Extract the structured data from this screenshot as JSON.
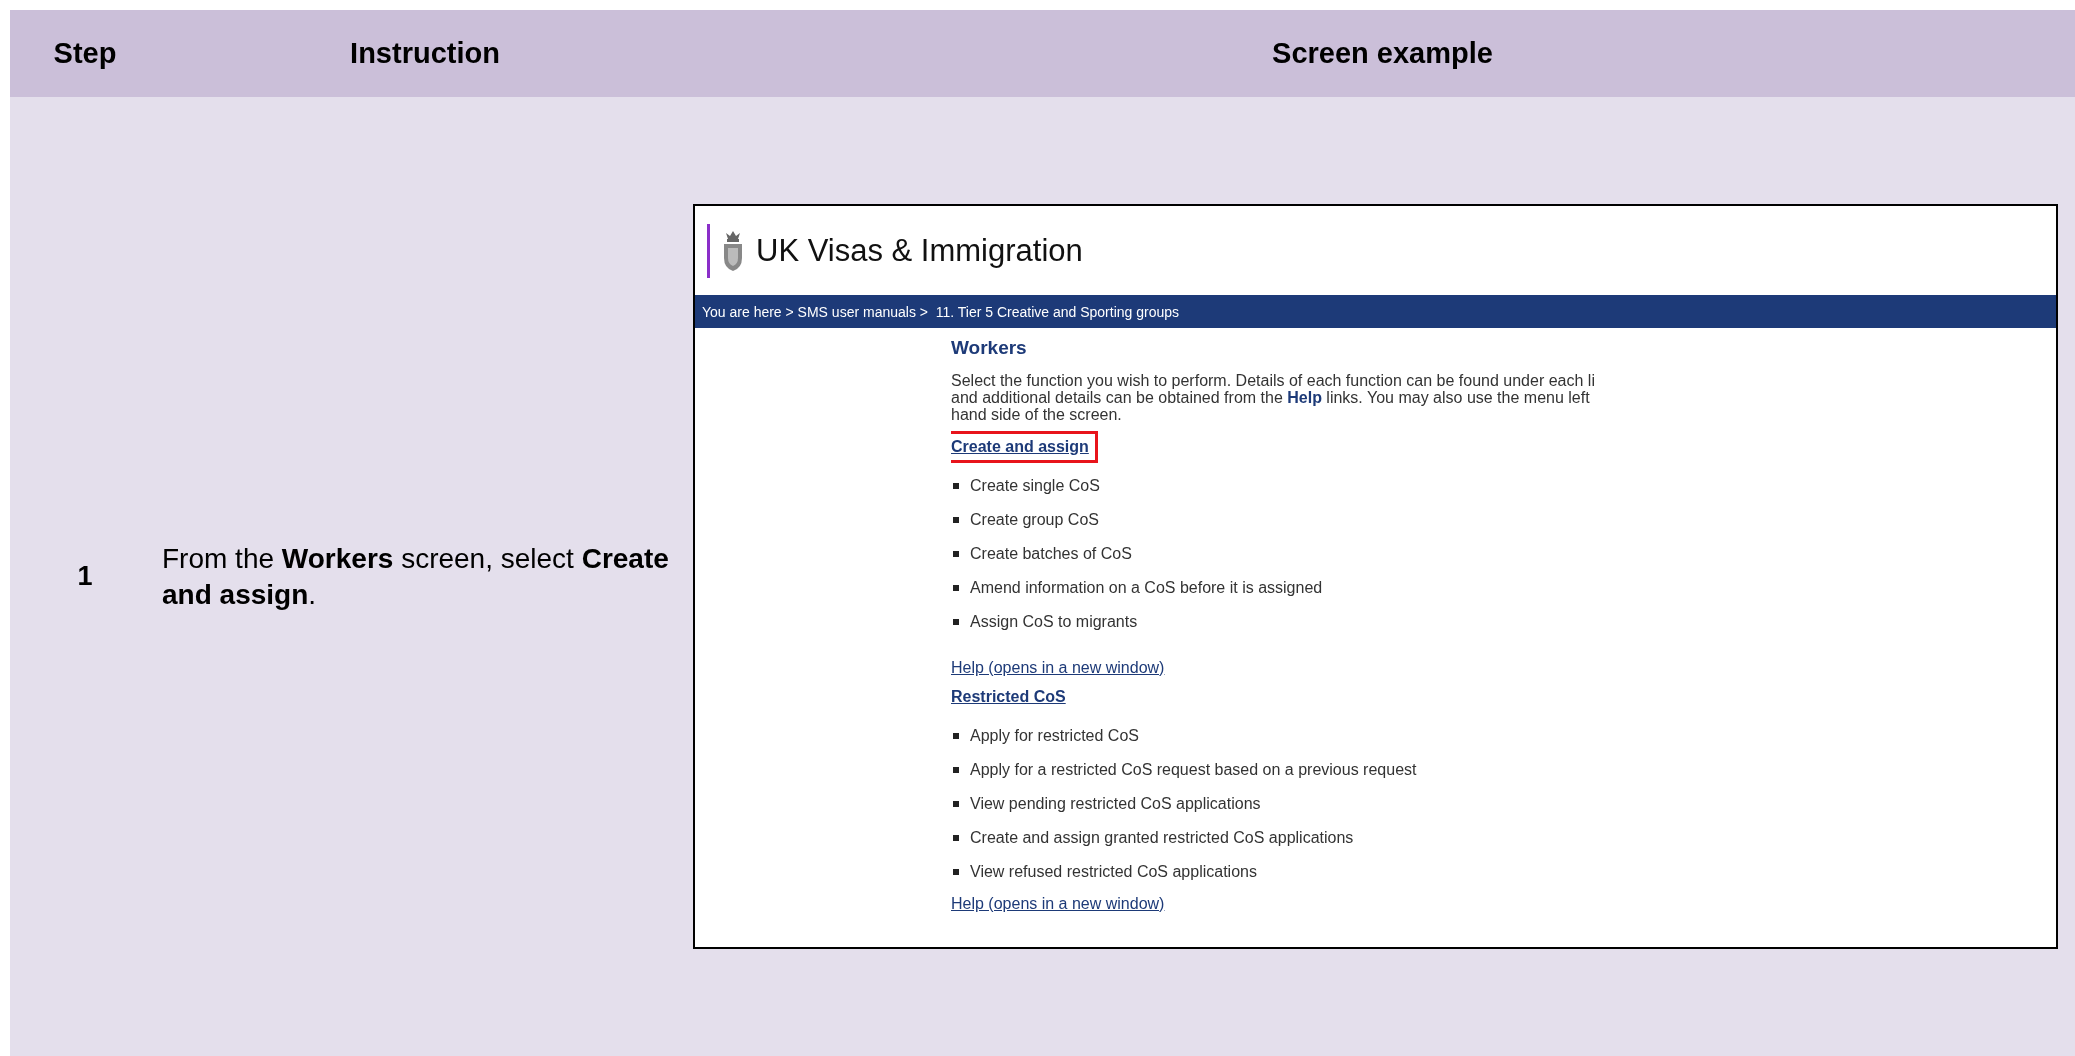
{
  "header": {
    "columns": [
      "Step",
      "Instruction",
      "Screen example"
    ]
  },
  "rows": [
    {
      "step": "1",
      "instruction": "From the **Workers** screen, select **Create and assign**.",
      "screen": {
        "logo": "UK Visas & Immigration",
        "breadcrumb": "You are here > SMS user manuals >  11. Tier 5 Creative and Sporting groups",
        "heading": "Workers",
        "intro": [
          "Select the function you wish to perform. Details of each function can be found under each li",
          "and additional details can be obtained from the **Help** links. You may also use the menu left",
          "hand side of the screen."
        ],
        "sections": [
          {
            "title": "Create and assign",
            "highlighted": true,
            "items": [
              "Create single CoS",
              "Create group CoS",
              "Create batches of CoS",
              "Amend information on a CoS before it is assigned",
              "Assign CoS to migrants"
            ],
            "help": "Help (opens in a new window)"
          },
          {
            "title": "Restricted CoS",
            "highlighted": false,
            "items": [
              "Apply for restricted CoS",
              "Apply for a restricted CoS request based on a previous request",
              "View pending restricted CoS applications",
              "Create and assign granted restricted CoS applications",
              "View refused restricted CoS applications"
            ],
            "help": "Help (opens in a new window)"
          }
        ]
      }
    }
  ]
}
